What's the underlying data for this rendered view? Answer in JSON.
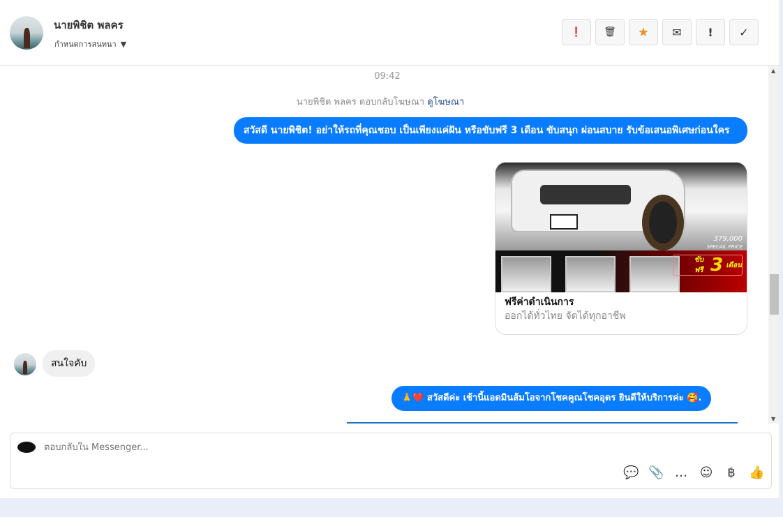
{
  "header": {
    "contact_name": "นายพิชิต พลคร",
    "assign_label": "กำหนดการสนทนา",
    "actions": [
      {
        "name": "spam",
        "glyph": "❗"
      },
      {
        "name": "delete",
        "glyph": "🗑"
      },
      {
        "name": "star",
        "glyph": "★"
      },
      {
        "name": "mark-unread",
        "glyph": "✉"
      },
      {
        "name": "important",
        "glyph": "!"
      },
      {
        "name": "done",
        "glyph": "✓"
      }
    ]
  },
  "chat": {
    "time": "09:42",
    "ad_reply_text": "นายพิชิต พลคร ตอบกลับโฆษณา",
    "ad_link": "ดูโฆษณา",
    "msg1": "สวัสดี นายพิชิต! อย่าให้รถที่คุณชอบ เป็นเพียงแค่ฝัน หรือขับฟรี 3 เดือน ขับสนุก ผ่อนสบาย รับข้อเสนอพิเศษก่อนใคร",
    "card": {
      "title": "ฟรีค่าดำเนินการ",
      "subtitle": "ออกได้ทั่วไทย จัดได้ทุกอาชีพ",
      "image_price": "379,000",
      "image_price_label": "SPECAIL PRICE",
      "image_promo": "ขับฟรี",
      "image_promo_num": "3",
      "image_promo_unit": "เดือน"
    },
    "msg2": "สนใจคับ",
    "msg3": "🙏❤️ สวัสดีค่ะ เช้านี้แอดมินส้มโอจากโชคคูณโชคอุดร ยินดีให้บริการค่ะ 🥰."
  },
  "composer": {
    "placeholder": "ตอบกลับใน Messenger...",
    "tools": [
      {
        "name": "saved-reply",
        "glyph": "💬"
      },
      {
        "name": "attach",
        "glyph": "📎"
      },
      {
        "name": "quick-reply",
        "glyph": "…"
      },
      {
        "name": "emoji",
        "glyph": "☺"
      },
      {
        "name": "payment",
        "glyph": "฿"
      },
      {
        "name": "like",
        "glyph": "👍"
      }
    ]
  }
}
